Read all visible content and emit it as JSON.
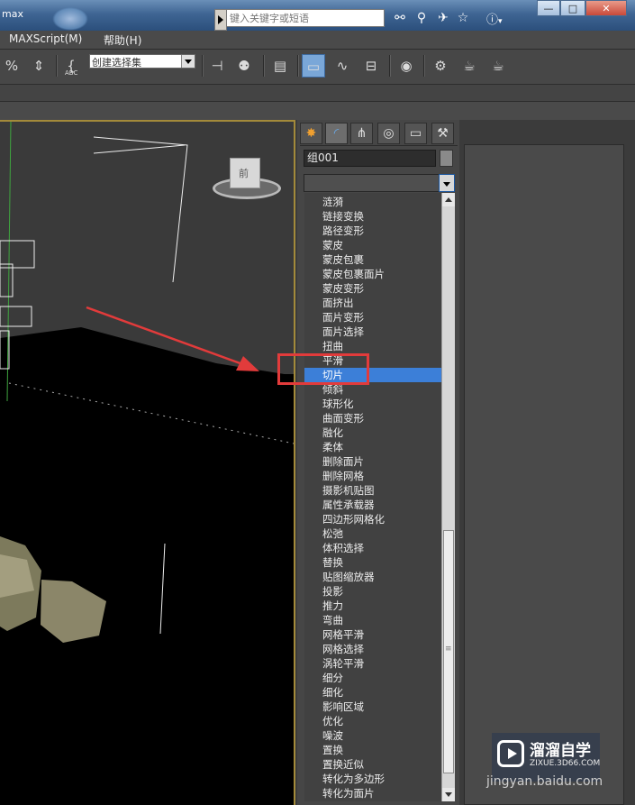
{
  "titlebar": {
    "title": "max",
    "search_placeholder": "键入关键字或短语"
  },
  "window_buttons": {
    "minimize": "—",
    "restore": "□",
    "close": "✕"
  },
  "menus": [
    "MAXScript(M)",
    "帮助(H)"
  ],
  "toolbar": {
    "selection_set_label": "创建选择集",
    "abc_label": "ABC"
  },
  "command_panel": {
    "object_name": "组001",
    "modifier_list_value": "",
    "modifiers": [
      "涟漪",
      "链接变换",
      "路径变形",
      "蒙皮",
      "蒙皮包裹",
      "蒙皮包裹面片",
      "蒙皮变形",
      "面挤出",
      "面片变形",
      "面片选择",
      "扭曲",
      "平滑",
      "切片",
      "倾斜",
      "球形化",
      "曲面变形",
      "融化",
      "柔体",
      "删除面片",
      "删除网格",
      "摄影机贴图",
      "属性承载器",
      "四边形网格化",
      "松弛",
      "体积选择",
      "替换",
      "贴图缩放器",
      "投影",
      "推力",
      "弯曲",
      "网格平滑",
      "网格选择",
      "涡轮平滑",
      "细分",
      "细化",
      "影响区域",
      "优化",
      "噪波",
      "置换",
      "置换近似",
      "转化为多边形",
      "转化为面片"
    ],
    "selected_modifier": "切片"
  },
  "viewcube": {
    "label": "前"
  },
  "watermark": {
    "title": "溜溜自学",
    "subtitle": "ZIXUE.3D66.COM",
    "url": "jingyan.baidu.com"
  },
  "colors": {
    "selection": "#3c7fd8",
    "annotation_red": "#e23b3b"
  }
}
